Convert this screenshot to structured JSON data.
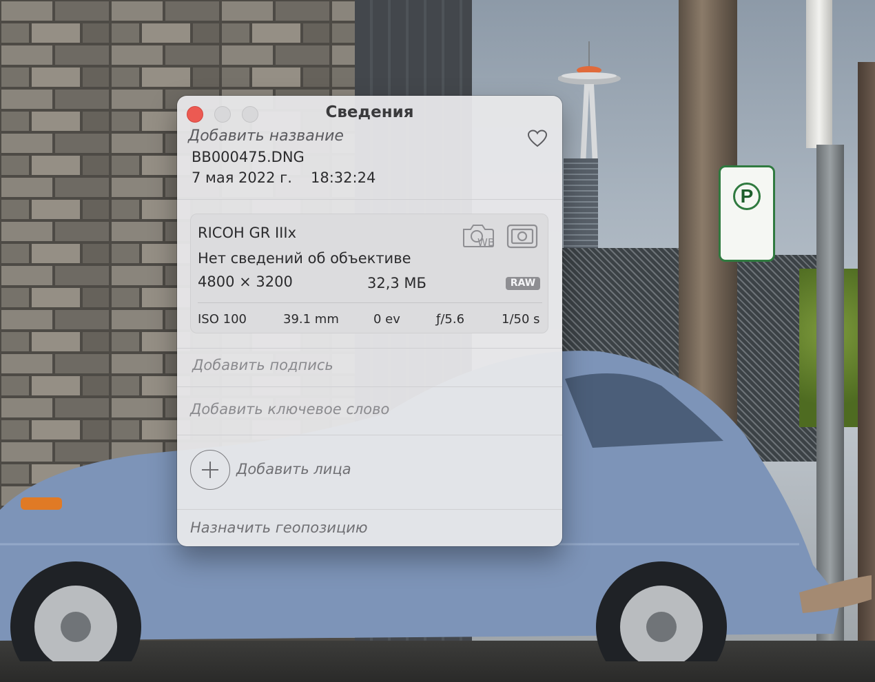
{
  "window": {
    "title": "Сведения"
  },
  "photo_info": {
    "add_title_placeholder": "Добавить название",
    "filename": "BB000475.DNG",
    "date": "7 мая 2022 г.",
    "time": "18:32:24"
  },
  "camera": {
    "model": "RICOH GR IIIx",
    "lens": "Нет сведений об объективе",
    "dimensions": "4800 × 3200",
    "file_size": "32,3 МБ",
    "format_badge": "RAW",
    "icons": [
      "white-balance-icon",
      "metering-icon"
    ]
  },
  "exif": {
    "iso": "ISO 100",
    "focal_length": "39.1 mm",
    "exposure_bias": "0 ev",
    "aperture": "ƒ/5.6",
    "shutter": "1/50 s"
  },
  "fields": {
    "caption_placeholder": "Добавить подпись",
    "keyword_placeholder": "Добавить ключевое слово",
    "faces_label": "Добавить лица",
    "location_placeholder": "Назначить геопозицию"
  },
  "colors": {
    "close_button": "#ec5a52",
    "panel_background": "#e8e8ea",
    "badge_background": "#8e8e92"
  }
}
